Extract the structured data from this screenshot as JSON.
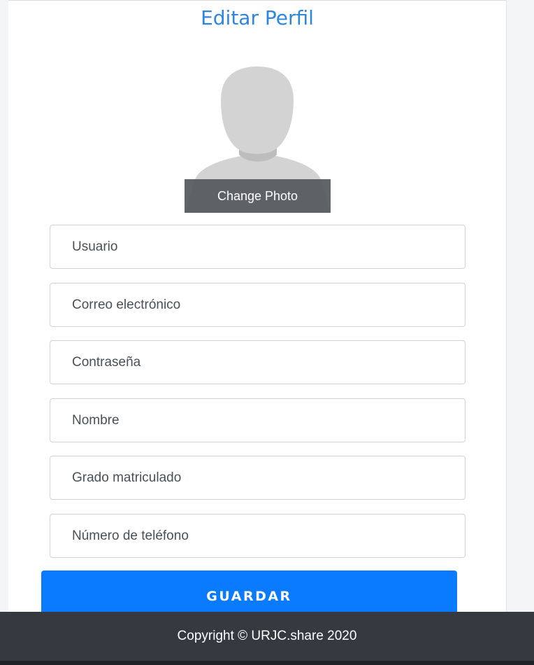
{
  "profile": {
    "title": "Editar Perfil",
    "change_photo_label": "Change Photo"
  },
  "form": {
    "fields": [
      {
        "name": "usuario",
        "placeholder": "Usuario",
        "value": ""
      },
      {
        "name": "correo",
        "placeholder": "Correo electrónico",
        "value": ""
      },
      {
        "name": "contrasena",
        "placeholder": "Contraseña",
        "value": ""
      },
      {
        "name": "nombre",
        "placeholder": "Nombre",
        "value": ""
      },
      {
        "name": "grado",
        "placeholder": "Grado matriculado",
        "value": ""
      },
      {
        "name": "telefono",
        "placeholder": "Número de teléfono",
        "value": ""
      }
    ],
    "submit_label": "GUARDAR"
  },
  "footer": {
    "copyright": "Copyright © URJC.share 2020"
  },
  "colors": {
    "accent": "#0a7bff",
    "title": "#2e86de",
    "footer_bg": "#343a40"
  },
  "icons": {
    "avatar": "default-user-silhouette-icon"
  }
}
